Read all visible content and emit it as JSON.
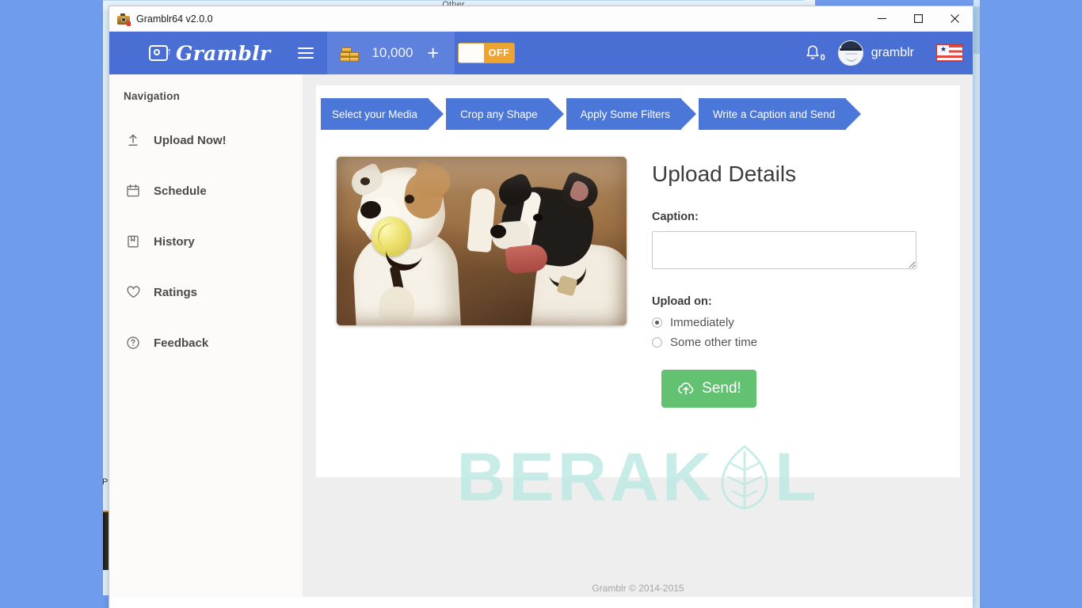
{
  "desktop": {
    "background_color": "#6f9ced",
    "bg_window_label": "Other",
    "bg_side_label": "PC"
  },
  "window": {
    "title": "Gramblr64 v2.0.0",
    "app_icon": "camera-icon",
    "controls": {
      "minimize": "minimize-icon",
      "maximize": "maximize-icon",
      "close": "close-icon"
    }
  },
  "topnav": {
    "brand": "Gramblr",
    "brand_icon": "camera-upload-icon",
    "menu_icon": "hamburger-icon",
    "coins_icon": "coins-icon",
    "coins": "10,000",
    "add_coins": "+",
    "toggle": {
      "state_label": "OFF",
      "color": "#f0a430"
    },
    "notifications": {
      "icon": "bell-icon",
      "count": "0"
    },
    "user": {
      "name": "gramblr",
      "avatar": "avatar-icon"
    },
    "language_flag": "us-flag-icon",
    "background_color": "#4a6fd4"
  },
  "sidebar": {
    "title": "Navigation",
    "items": [
      {
        "label": "Upload Now!",
        "icon": "upload-arrow-icon"
      },
      {
        "label": "Schedule",
        "icon": "calendar-icon"
      },
      {
        "label": "History",
        "icon": "book-icon"
      },
      {
        "label": "Ratings",
        "icon": "heart-icon"
      },
      {
        "label": "Feedback",
        "icon": "question-circle-icon"
      }
    ]
  },
  "steps": [
    {
      "label": "Select your Media"
    },
    {
      "label": "Crop any Shape"
    },
    {
      "label": "Apply Some Filters"
    },
    {
      "label": "Write a Caption and Send"
    }
  ],
  "preview": {
    "alt": "two-jack-russell-terriers-with-tennis-ball"
  },
  "details": {
    "title": "Upload Details",
    "caption_label": "Caption:",
    "caption_value": "",
    "caption_placeholder": "",
    "upload_on_label": "Upload on:",
    "options": [
      {
        "label": "Immediately",
        "selected": true
      },
      {
        "label": "Some other time",
        "selected": false
      }
    ],
    "send_button": "Send!",
    "send_icon": "cloud-upload-icon",
    "send_color": "#62c271"
  },
  "watermark": {
    "text_before": "BERAK",
    "text_after": "L",
    "icon": "leaf-icon",
    "color": "#bfe9e4"
  },
  "footer": {
    "text": "Gramblr © 2014-2015"
  }
}
